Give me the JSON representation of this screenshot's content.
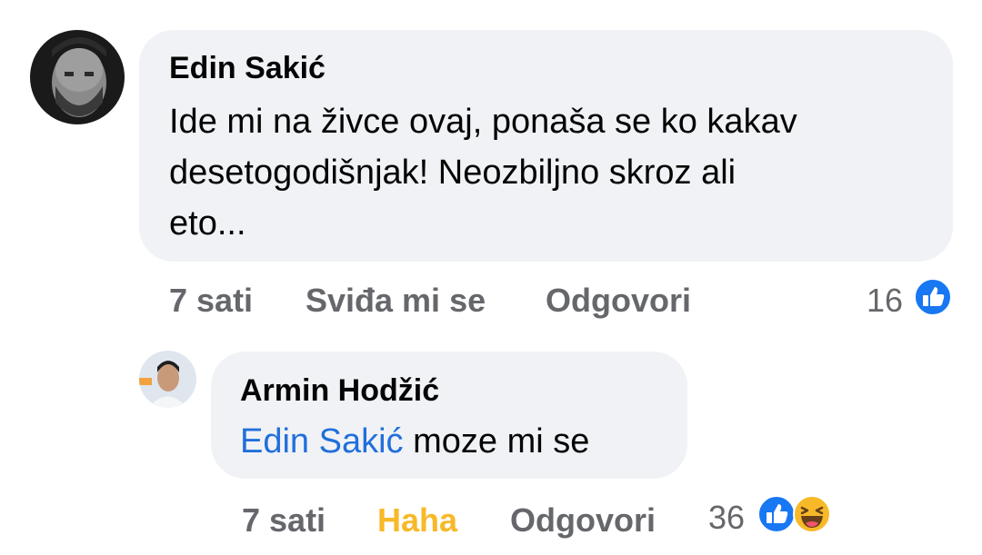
{
  "comments": [
    {
      "author": "Edin Sakić",
      "text_lines": [
        "Ide mi na živce ovaj, ponaša se ko kakav",
        "desetogodišnjak! Neozbiljno skroz ali",
        "eto..."
      ],
      "time": "7 sati",
      "like_action": "Sviđa mi se",
      "reply_action": "Odgovori",
      "reaction_count": "16",
      "reactions": [
        "like-icon"
      ]
    },
    {
      "author": "Armin Hodžić",
      "mention": "Edin Sakić",
      "text": " moze mi se",
      "time": "7 sati",
      "like_action": "Haha",
      "reply_action": "Odgovori",
      "reaction_count": "36",
      "reactions": [
        "like-icon",
        "haha-icon"
      ]
    }
  ],
  "colors": {
    "bubble": "#f0f2f5",
    "meta_text": "#65676b",
    "mention": "#216fdb",
    "haha_active": "#f7b928",
    "like_blue": "#1877f2"
  }
}
